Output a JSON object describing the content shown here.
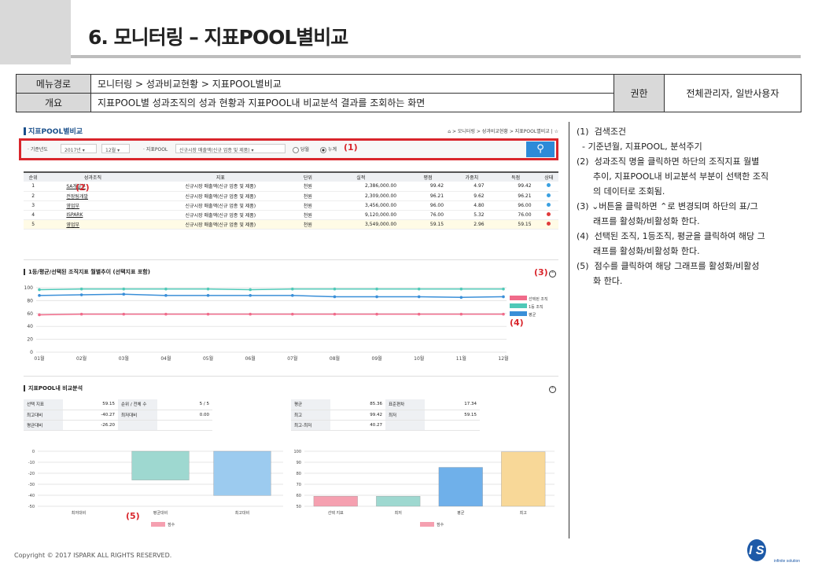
{
  "page_title": "6. 모니터링 – 지표POOL별비교",
  "meta": {
    "menu_label": "메뉴경로",
    "menu_path": "모니터링  >  성과비교현황  >  지표POOL별비교",
    "overview_label": "개요",
    "overview_text": "지표POOL별 성과조직의 성과 현황과 지표POOL내 비교분석 결과를 조회하는 화면",
    "auth_label": "권한",
    "auth_value": "전체관리자, 일반사용자"
  },
  "screen": {
    "title": "지표POOL별비교",
    "breadcrumb": "⌂ > 모니터링 > 성과비교현황 > 지표POOL별비교 | ☆",
    "filter": {
      "year_label": "· 기준년도",
      "year_value": "2017년",
      "month_value": "12월",
      "pool_label": "· 지표POOL",
      "pool_value": "신규시장 매출액(신규 업종 및 제품)",
      "radio1": "당월",
      "radio2": "누계",
      "marker": "(1)"
    },
    "table": {
      "headers": [
        "순위",
        "성과조직",
        "지표",
        "단위",
        "실적",
        "평점",
        "가중치",
        "득점",
        "상태"
      ],
      "rows": [
        {
          "rank": "1",
          "org": "SA개발부",
          "kpi": "신규시장 매출액(신규 업종 및 제품)",
          "unit": "천원",
          "actual": "2,386,000.00",
          "score": "99.42",
          "weight": "4.97",
          "points": "99.42",
          "status_color": "#3ba0e0"
        },
        {
          "rank": "2",
          "org": "전장팀개발",
          "kpi": "신규시장 매출액(신규 업종 및 제품)",
          "unit": "천원",
          "actual": "2,309,000.00",
          "score": "96.21",
          "weight": "9.62",
          "points": "96.21",
          "status_color": "#3ba0e0"
        },
        {
          "rank": "3",
          "org": "영업부",
          "kpi": "신규시장 매출액(신규 업종 및 제품)",
          "unit": "천원",
          "actual": "3,456,000.00",
          "score": "96.00",
          "weight": "4.80",
          "points": "96.00",
          "status_color": "#3ba0e0"
        },
        {
          "rank": "4",
          "org": "ISPARK",
          "kpi": "신규시장 매출액(신규 업종 및 제품)",
          "unit": "천원",
          "actual": "9,120,000.00",
          "score": "76.00",
          "weight": "5.32",
          "points": "76.00",
          "status_color": "#e03b3b"
        },
        {
          "rank": "5",
          "org": "영업부",
          "kpi": "신규시장 매출액(신규 업종 및 제품)",
          "unit": "천원",
          "actual": "3,549,000.00",
          "score": "59.15",
          "weight": "2.96",
          "points": "59.15",
          "status_color": "#e03b3b"
        }
      ],
      "marker": "(2)"
    },
    "trend": {
      "title": "1등/평균/선택된 조직지표 월별추이 (선택지표 포함)",
      "marker3": "(3)",
      "marker4": "(4)"
    },
    "compare": {
      "title": "지표POOL내 비교분석",
      "left": [
        [
          "선택 지표",
          "59.15",
          "순위 / 전체 수",
          "5 / 5"
        ],
        [
          "최고대비",
          "-40.27",
          "최저대비",
          "0.00"
        ],
        [
          "평균대비",
          "-26.20",
          "",
          ""
        ]
      ],
      "right": [
        [
          "평균",
          "85.36",
          "표준편차",
          "17.34"
        ],
        [
          "최고",
          "99.42",
          "최저",
          "59.15"
        ],
        [
          "최고-최저",
          "40.27",
          "",
          ""
        ]
      ],
      "marker5": "(5)",
      "legend": "점수"
    }
  },
  "chart_data": [
    {
      "type": "line",
      "x": [
        "01월",
        "02월",
        "03월",
        "04월",
        "05월",
        "06월",
        "07월",
        "08월",
        "09월",
        "10월",
        "11월",
        "12월"
      ],
      "ylim": [
        0,
        100
      ],
      "yticks": [
        0,
        20,
        40,
        60,
        80,
        100
      ],
      "series": [
        {
          "name": "선택된 조직",
          "color": "#f06b8a",
          "values": [
            58,
            59,
            59,
            59,
            59,
            59,
            59,
            59,
            59,
            59,
            59,
            59
          ]
        },
        {
          "name": "1등 조직",
          "color": "#4ec9b8",
          "values": [
            97,
            98,
            98,
            98,
            98,
            97,
            98,
            98,
            98,
            98,
            98,
            98
          ]
        },
        {
          "name": "평균",
          "color": "#3a8fd8",
          "values": [
            88,
            89,
            90,
            88,
            88,
            88,
            88,
            86,
            86,
            86,
            85,
            86
          ]
        }
      ]
    },
    {
      "type": "bar",
      "categories": [
        "최저대비",
        "평균대비",
        "최고대비"
      ],
      "values": [
        0,
        -26.2,
        -40.27
      ],
      "colors": [
        "#f5a0b0",
        "#9ed8d0",
        "#9ccbef"
      ],
      "ylim": [
        -50,
        0
      ],
      "yticks": [
        0,
        -10,
        -20,
        -30,
        -40,
        -50
      ],
      "legend": "점수"
    },
    {
      "type": "bar",
      "categories": [
        "선택 지표",
        "최저",
        "평균",
        "최고"
      ],
      "values": [
        59.15,
        59.15,
        85.36,
        99.42
      ],
      "colors": [
        "#f5a0b0",
        "#9ed8d0",
        "#6fb0ea",
        "#f8d898"
      ],
      "ylim": [
        50,
        100
      ],
      "yticks": [
        50,
        60,
        70,
        80,
        90,
        100
      ],
      "legend": "점수"
    }
  ],
  "notes": [
    "(1)  검색조건",
    "  - 기준년월, 지표POOL, 분석주기",
    "(2)  성과조직 명을 클릭하면 하단의 조직지표 월별",
    "      추이, 지표POOL내 비교분석 부분이 선택한 조직",
    "      의 데이터로 조회됨.",
    "(3) ⌄버튼을 클릭하면 ⌃로 변경되며 하단의 표/그",
    "      래프를 활성화/비활성화 한다.",
    "(4)  선택된 조직, 1등조직, 평균을 클릭하여 해당 그",
    "      래프를 활성화/비활성화 한다.",
    "(5)  점수를 클릭하여 해당 그래프를 활성화/비활성",
    "      화 한다."
  ],
  "footer": "Copyright © 2017 ISPARK ALL RIGHTS RESERVED.",
  "logo_text": "ISPark",
  "logo_sub": "infinite solution"
}
